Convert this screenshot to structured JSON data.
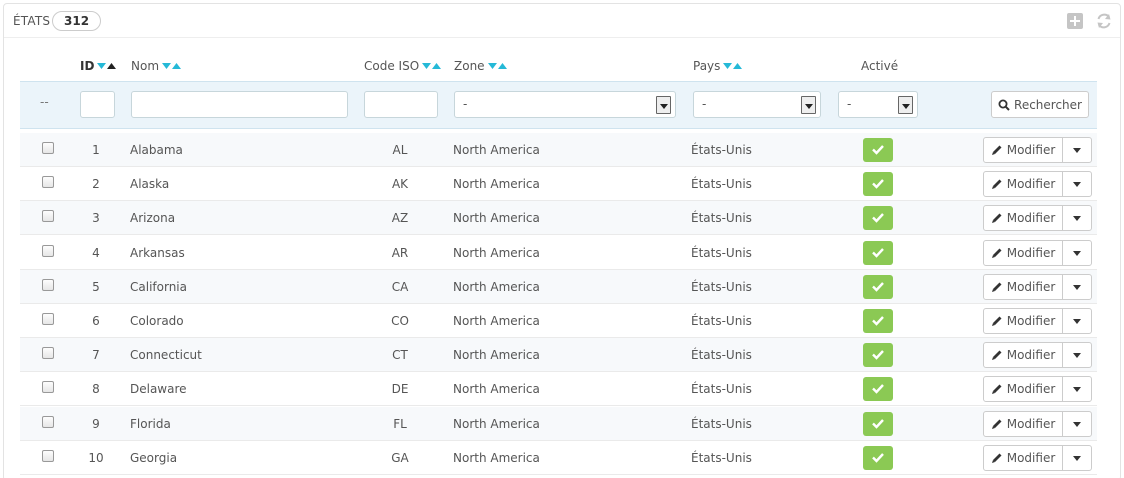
{
  "panel": {
    "title": "États",
    "count": "312"
  },
  "columns": {
    "id": "ID",
    "name": "Nom",
    "iso": "Code ISO",
    "zone": "Zone",
    "country": "Pays",
    "active": "Activé"
  },
  "filters": {
    "bulk": "--",
    "zone_selected": "-",
    "country_selected": "-",
    "active_selected": "-",
    "search_label": "Rechercher"
  },
  "row_action": {
    "edit_label": "Modifier"
  },
  "colors": {
    "sort_arrow": "#25b9d7",
    "active_green": "#8bc954",
    "filter_bg": "#ebf4fa"
  },
  "rows": [
    {
      "id": "1",
      "name": "Alabama",
      "iso": "AL",
      "zone": "North America",
      "country": "États-Unis",
      "active": true
    },
    {
      "id": "2",
      "name": "Alaska",
      "iso": "AK",
      "zone": "North America",
      "country": "États-Unis",
      "active": true
    },
    {
      "id": "3",
      "name": "Arizona",
      "iso": "AZ",
      "zone": "North America",
      "country": "États-Unis",
      "active": true
    },
    {
      "id": "4",
      "name": "Arkansas",
      "iso": "AR",
      "zone": "North America",
      "country": "États-Unis",
      "active": true
    },
    {
      "id": "5",
      "name": "California",
      "iso": "CA",
      "zone": "North America",
      "country": "États-Unis",
      "active": true
    },
    {
      "id": "6",
      "name": "Colorado",
      "iso": "CO",
      "zone": "North America",
      "country": "États-Unis",
      "active": true
    },
    {
      "id": "7",
      "name": "Connecticut",
      "iso": "CT",
      "zone": "North America",
      "country": "États-Unis",
      "active": true
    },
    {
      "id": "8",
      "name": "Delaware",
      "iso": "DE",
      "zone": "North America",
      "country": "États-Unis",
      "active": true
    },
    {
      "id": "9",
      "name": "Florida",
      "iso": "FL",
      "zone": "North America",
      "country": "États-Unis",
      "active": true
    },
    {
      "id": "10",
      "name": "Georgia",
      "iso": "GA",
      "zone": "North America",
      "country": "États-Unis",
      "active": true
    }
  ]
}
